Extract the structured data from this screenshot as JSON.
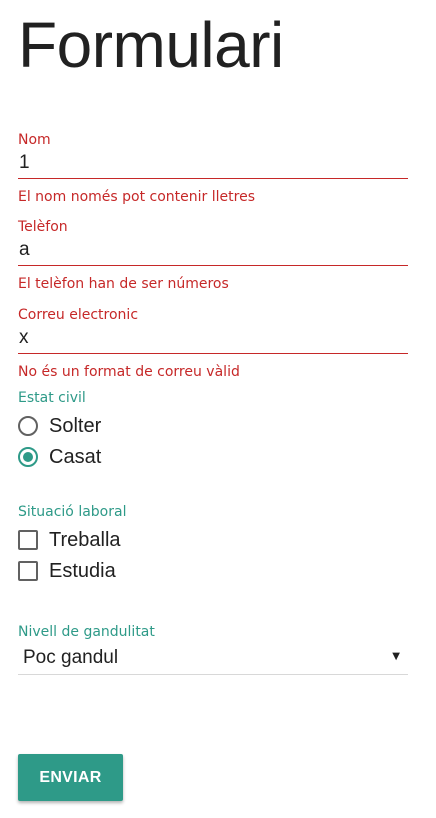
{
  "page": {
    "title": "Formulari"
  },
  "fields": {
    "nom": {
      "label": "Nom",
      "value": "1",
      "error": "El nom només pot contenir lletres"
    },
    "telefon": {
      "label": "Telèfon",
      "value": "a",
      "error": "El telèfon han de ser números"
    },
    "correu": {
      "label": "Correu electronic",
      "value": "x",
      "error": "No és un format de correu vàlid"
    }
  },
  "estat_civil": {
    "label": "Estat civil",
    "options": [
      {
        "label": "Solter",
        "checked": false
      },
      {
        "label": "Casat",
        "checked": true
      }
    ]
  },
  "situacio_laboral": {
    "label": "Situació laboral",
    "options": [
      {
        "label": "Treballa",
        "checked": false
      },
      {
        "label": "Estudia",
        "checked": false
      }
    ]
  },
  "gandulitat": {
    "label": "Nivell de gandulitat",
    "selected": "Poc gandul"
  },
  "submit": {
    "label": "ENVIAR"
  },
  "colors": {
    "error": "#c62828",
    "accent": "#2e9a88",
    "text": "#212121"
  },
  "icons": {
    "select_arrow": "dropdown-arrow-icon"
  }
}
